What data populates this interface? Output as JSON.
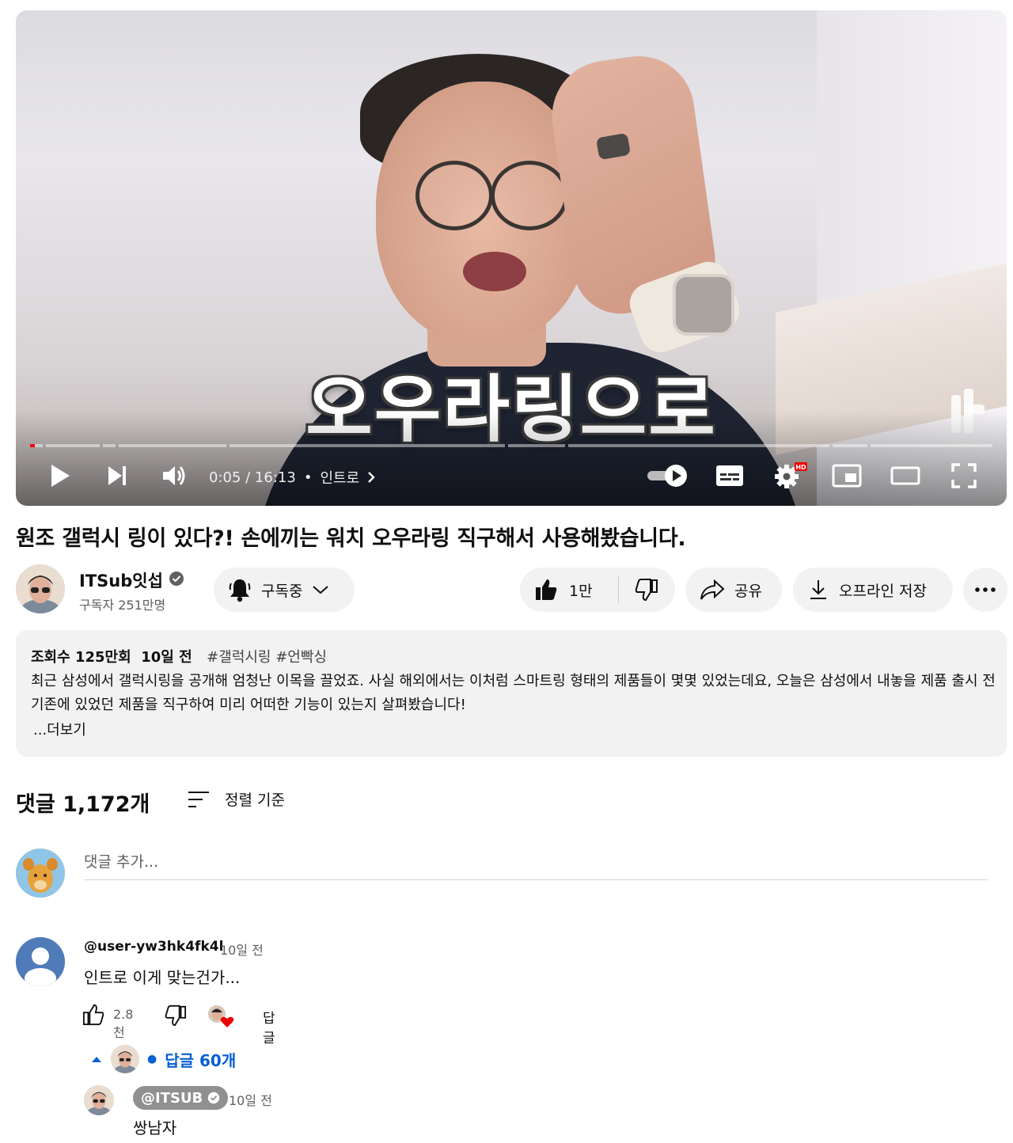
{
  "player": {
    "caption": "오우라링으로",
    "current_time": "0:05",
    "duration": "16:13",
    "time_display": "0:05 / 16:13",
    "chapter": "인트로",
    "progress_fraction": 0.0051,
    "hd_badge": "HD",
    "controls": [
      "play-icon",
      "next-icon",
      "volume-icon",
      "autoplay-toggle",
      "subtitles-icon",
      "settings-icon",
      "miniplayer-icon",
      "theater-icon",
      "fullscreen-icon"
    ]
  },
  "video": {
    "title": "원조 갤럭시 링이 있다?! 손에끼는 워치 오우라링 직구해서 사용해봤습니다.",
    "channel_name": "ITSub잇섭",
    "subscribers": "구독자 251만명",
    "subscribe_label": "구독중",
    "likes": "1만",
    "share_label": "공유",
    "download_label": "오프라인 저장"
  },
  "description": {
    "views": "조회수 125만회",
    "age": "10일 전",
    "tags": "#갤럭시링 #언빡싱",
    "text": "최근 삼성에서 갤럭시링을 공개해 엄청난 이목을 끌었죠. 사실 해외에서는 이처럼 스마트링 형태의 제품들이 몇몇 있었는데요, 오늘은 삼성에서 내놓을 제품 출시 전 기존에 있었던 제품을 직구하여 미리 어떠한 기능이 있는지 살펴봤습니다!",
    "more_label": "...더보기"
  },
  "comments": {
    "header": "댓글 1,172개",
    "sort_label": "정렬 기준",
    "add_placeholder": "댓글 추가...",
    "items": [
      {
        "author": "@user-yw3hk4fk4l",
        "time": "10일 전",
        "text": "인트로 이게 맞는건가...",
        "likes": "2.8천",
        "reply_label": "답글",
        "replies_label": "답글 60개",
        "replies": [
          {
            "author": "@ITSUB",
            "time": "10일 전",
            "text": "쌍남자"
          }
        ]
      }
    ]
  },
  "colors": {
    "progress": "#ff0000",
    "link": "#065fd4",
    "pill_bg": "#f2f2f2"
  }
}
